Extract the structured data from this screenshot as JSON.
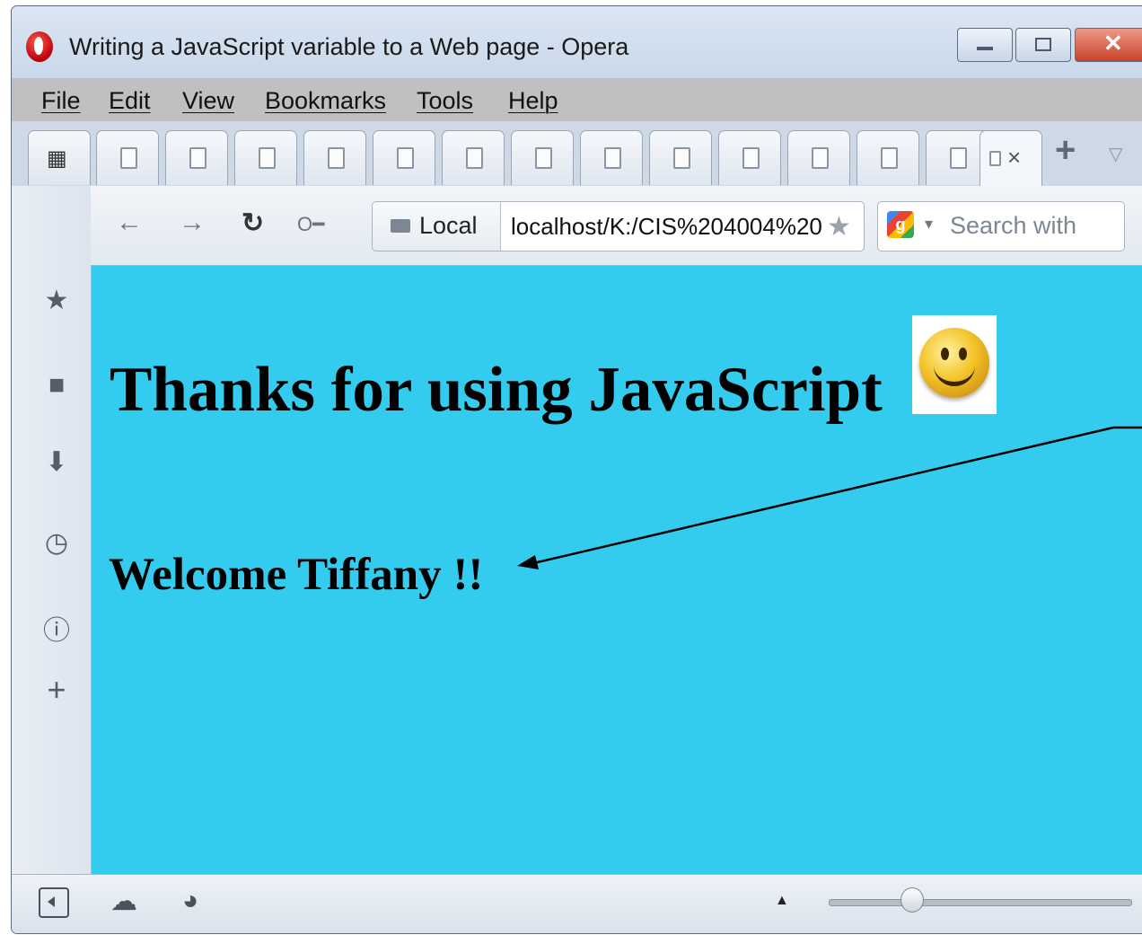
{
  "window": {
    "title": "Writing a JavaScript variable to a Web page - Opera",
    "minimize_icon": "minimize-icon",
    "maximize_icon": "maximize-icon",
    "close_icon": "close-icon"
  },
  "menu": {
    "items": [
      "File",
      "Edit",
      "View",
      "Bookmarks",
      "Tools",
      "Help"
    ]
  },
  "tabs": {
    "count": 14,
    "active_close": "×",
    "add_label": "+"
  },
  "address": {
    "badge": "Local",
    "url": "localhost/K:/CIS%204004%20",
    "search_placeholder": "Search with"
  },
  "page": {
    "heading": "Thanks for using JavaScript",
    "welcome": "Welcome Tiffany !!",
    "background": "#33ccee"
  },
  "sidebar": {
    "icons": [
      "star-icon",
      "note-icon",
      "download-icon",
      "history-icon",
      "info-icon",
      "plus-icon"
    ]
  }
}
